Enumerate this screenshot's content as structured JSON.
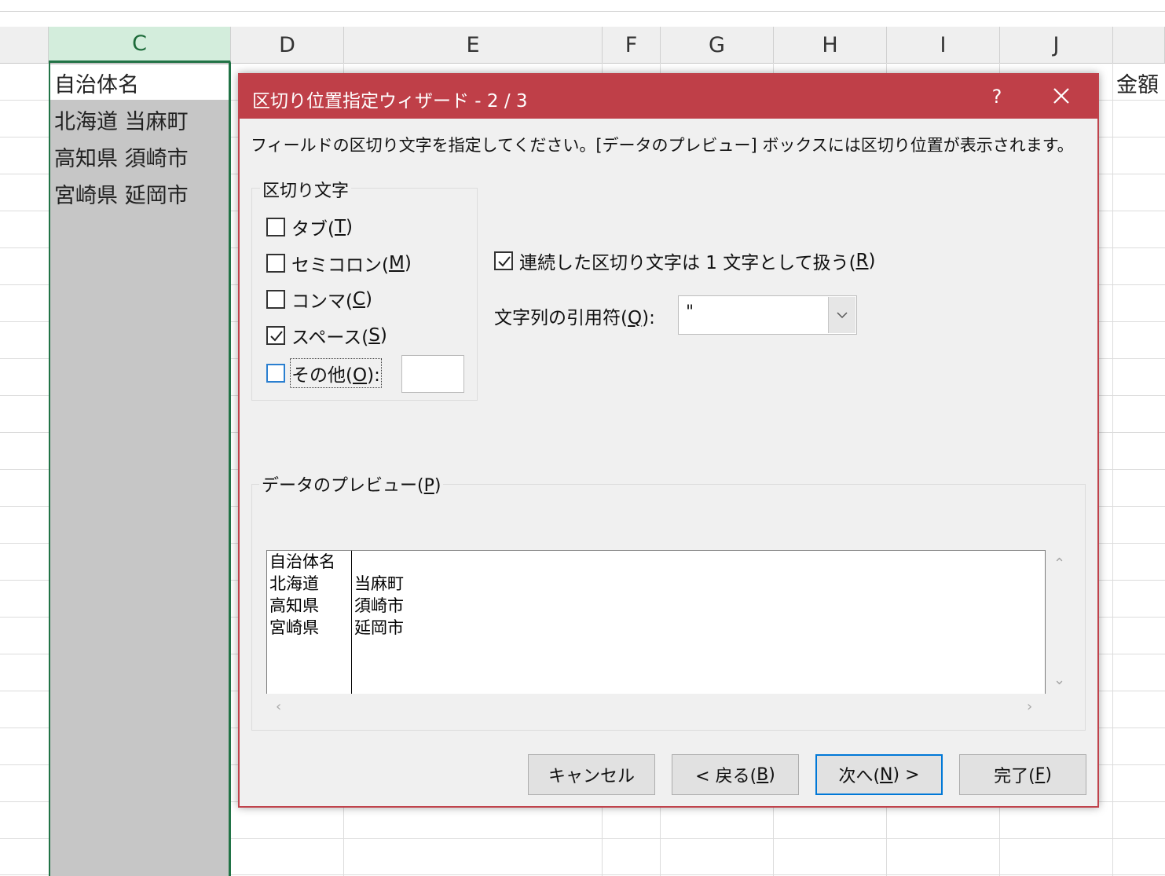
{
  "sheet": {
    "columns": [
      "C",
      "D",
      "E",
      "F",
      "G",
      "H",
      "I",
      "J"
    ],
    "selected_column": "C",
    "column_c_cells": [
      "自治体名",
      "北海道 当麻町",
      "高知県 須崎市",
      "宮崎県 延岡市"
    ],
    "right_edge_header": "金額"
  },
  "dialog": {
    "title": "区切り位置指定ウィザード - 2 / 3",
    "help_label": "?",
    "description": "フィールドの区切り文字を指定してください。[データのプレビュー] ボックスには区切り位置が表示されます。",
    "delimiters_group_label": "区切り文字",
    "delimiters": [
      {
        "label": "タブ(",
        "key": "T",
        "checked": false
      },
      {
        "label": "セミコロン(",
        "key": "M",
        "checked": false
      },
      {
        "label": "コンマ(",
        "key": "C",
        "checked": false
      },
      {
        "label": "スペース(",
        "key": "S",
        "checked": true
      },
      {
        "label": "その他(",
        "key": "O",
        "checked": false,
        "suffix": "):"
      }
    ],
    "consecutive": {
      "label": "連続した区切り文字は 1 文字として扱う(",
      "key": "R",
      "checked": true
    },
    "quote": {
      "label": "文字列の引用符(",
      "key": "Q",
      "suffix": "):",
      "value": "\""
    },
    "preview_label": "データのプレビュー(",
    "preview_key": "P",
    "preview_col1": [
      "自治体名",
      "北海道",
      "高知県",
      "宮崎県"
    ],
    "preview_col2": [
      "",
      "当麻町",
      "須崎市",
      "延岡市"
    ],
    "buttons": {
      "cancel": "キャンセル",
      "back": "< 戻る(",
      "back_key": "B",
      "next": "次へ(",
      "next_key": "N",
      "next_suffix": ") >",
      "finish": "完了(",
      "finish_key": "F"
    }
  }
}
